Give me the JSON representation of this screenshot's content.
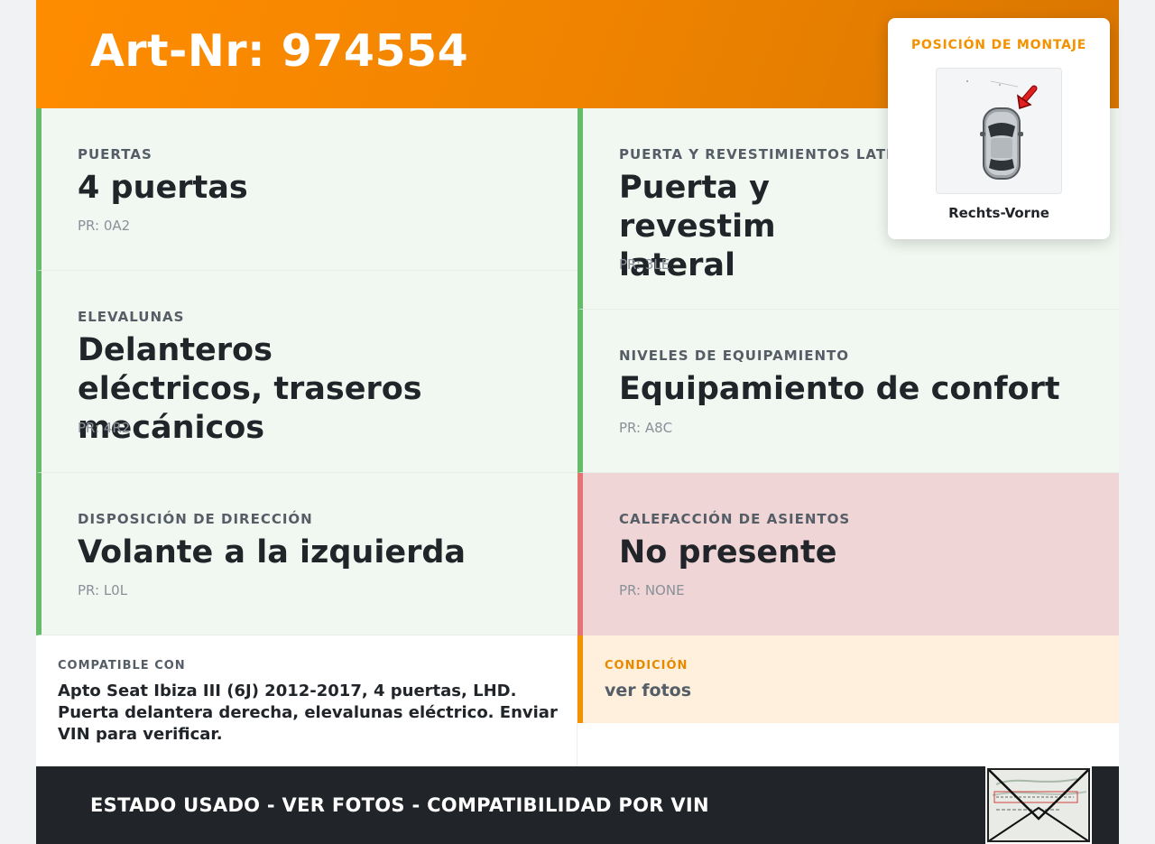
{
  "header": {
    "title": "Art-Nr: 974554"
  },
  "specs": [
    {
      "label": "PUERTAS",
      "value": "4 puertas",
      "pr": "PR: 0A2"
    },
    {
      "label": "PUERTA Y REVESTIMIENTOS LATER",
      "value": "Puerta y revestim lateral",
      "pr": "PR: 3LE"
    },
    {
      "label": "ELEVALUNAS",
      "value": "Delanteros eléctricos, traseros mecánicos",
      "pr": "PR: 4R2"
    },
    {
      "label": "NIVELES DE EQUIPAMIENTO",
      "value": "Equipamiento de confort",
      "pr": "PR: A8C"
    },
    {
      "label": "DISPOSICIÓN DE DIRECCIÓN",
      "value": "Volante a la izquierda",
      "pr": "PR: L0L"
    },
    {
      "label": "CALEFACCIÓN DE ASIENTOS",
      "value": "No presente",
      "pr": "PR: NONE"
    }
  ],
  "compatible": {
    "label": "COMPATIBLE CON",
    "text": "Apto Seat Ibiza III (6J) 2012-2017, 4 puertas, LHD. Puerta delantera derecha, elevalunas eléctrico. Enviar VIN para verificar."
  },
  "condition": {
    "label": "CONDICIÓN",
    "text": "ver fotos"
  },
  "footer": {
    "text": "ESTADO USADO - VER FOTOS - COMPATIBILIDAD POR VIN"
  },
  "mount": {
    "title": "POSICIÓN DE MONTAJE",
    "position": "Rechts-Vorne"
  },
  "colors": {
    "accent": "#f39200",
    "ok_border": "#66bb6a",
    "bad_border": "#e57373",
    "footer_bg": "#212529"
  },
  "icons": [
    "car-top-view-icon",
    "arrow-indicator-icon",
    "registration-document-icon"
  ]
}
